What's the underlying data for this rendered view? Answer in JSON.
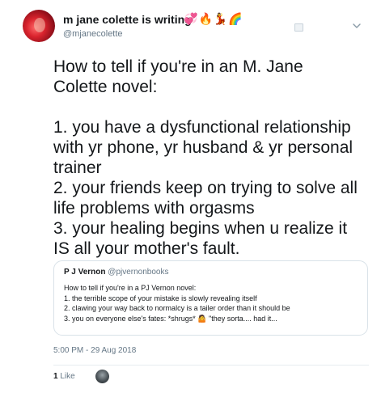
{
  "author": {
    "display_name": "m jane colette is writing",
    "name_emojis": [
      "💞",
      "🔥",
      "💃",
      "🌈"
    ],
    "handle": "@mjanecolette"
  },
  "tweet": {
    "text": "How to tell if you're in an M. Jane\nColette novel:\n\n1. you have a dysfunctional relationship\nwith yr phone, yr husband & yr personal\ntrainer\n2. your friends keep on trying to solve all\nlife problems with orgasms\n3. your healing begins when u realize it\nIS all your mother's fault."
  },
  "quoted_tweet": {
    "display_name": "P J Vernon",
    "handle": "@pjvernonbooks",
    "text": "How to tell if you're in a PJ Vernon novel:\n1. the terrible scope of your mistake is slowly revealing itself\n2. clawing your way back to normalcy is a tailer order than it should be\n3. you on everyone else's fates: *shrugs* 🤷 \"they sorta.... had it..."
  },
  "meta": {
    "timestamp": "5:00 PM - 29 Aug 2018",
    "like_count": "1",
    "like_label": "Like"
  },
  "icons": {
    "follow": "follow-badge-icon",
    "menu": "chevron-down-icon"
  },
  "colors": {
    "secondary_text": "#657786",
    "border": "#d9e2e8"
  }
}
